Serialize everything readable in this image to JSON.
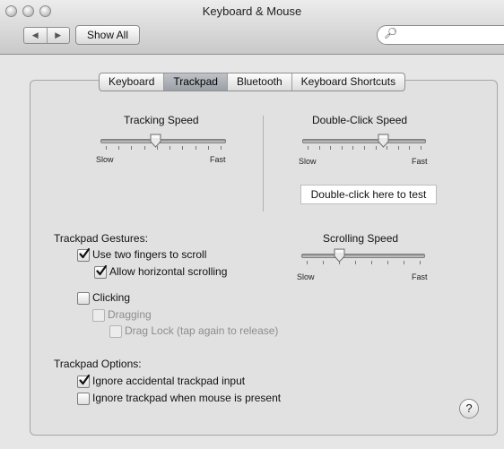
{
  "window": {
    "title": "Keyboard & Mouse",
    "back_icon": "back-arrow-icon",
    "forward_icon": "forward-arrow-icon",
    "show_all_label": "Show All",
    "search": {
      "value": "",
      "placeholder": ""
    }
  },
  "tabs": [
    {
      "label": "Keyboard",
      "selected": false
    },
    {
      "label": "Trackpad",
      "selected": true
    },
    {
      "label": "Bluetooth",
      "selected": false
    },
    {
      "label": "Keyboard Shortcuts",
      "selected": false
    }
  ],
  "tracking_speed": {
    "label": "Tracking Speed",
    "min_label": "Slow",
    "max_label": "Fast",
    "value": 0.43
  },
  "double_click_speed": {
    "label": "Double-Click Speed",
    "min_label": "Slow",
    "max_label": "Fast",
    "value": 0.67
  },
  "double_click_test_label": "Double-click here to test",
  "gestures": {
    "heading": "Trackpad Gestures:",
    "two_finger_scroll": {
      "label": "Use two fingers to scroll",
      "checked": true,
      "enabled": true
    },
    "horizontal_scroll": {
      "label": "Allow horizontal scrolling",
      "checked": true,
      "enabled": true
    },
    "clicking": {
      "label": "Clicking",
      "checked": false,
      "enabled": true
    },
    "dragging": {
      "label": "Dragging",
      "checked": false,
      "enabled": false
    },
    "drag_lock": {
      "label": "Drag Lock (tap again to release)",
      "checked": false,
      "enabled": false
    }
  },
  "scrolling_speed": {
    "label": "Scrolling Speed",
    "min_label": "Slow",
    "max_label": "Fast",
    "value": 0.29
  },
  "options": {
    "heading": "Trackpad Options:",
    "ignore_accidental": {
      "label": "Ignore accidental trackpad input",
      "checked": true,
      "enabled": true
    },
    "ignore_when_mouse": {
      "label": "Ignore trackpad when mouse is present",
      "checked": false,
      "enabled": true
    }
  },
  "help_label": "?"
}
